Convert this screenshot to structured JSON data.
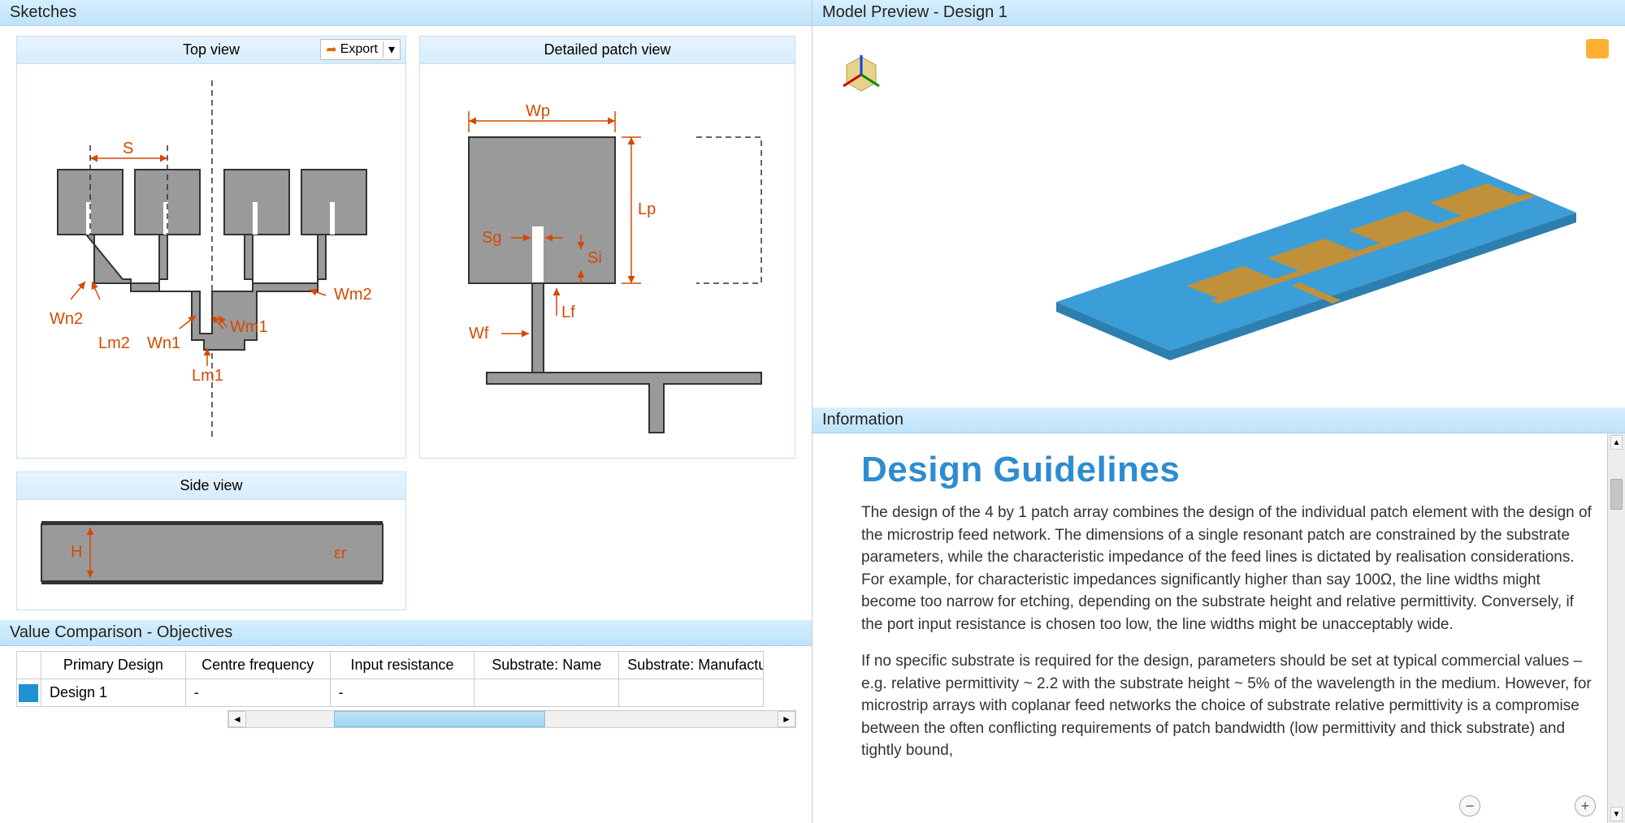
{
  "panels": {
    "sketches_title": "Sketches",
    "model_preview_title": "Model Preview  -  Design 1",
    "information_title": "Information",
    "value_comp_title": "Value Comparison - Objectives"
  },
  "sketches": {
    "top_view_title": "Top view",
    "detailed_view_title": "Detailed patch view",
    "side_view_title": "Side view",
    "export_label": "Export",
    "dim_labels_top": {
      "S": "S",
      "Wn2": "Wn2",
      "Lm2": "Lm2",
      "Wn1": "Wn1",
      "Lm1": "Lm1",
      "Wm1": "Wm1",
      "Wm2": "Wm2"
    },
    "dim_labels_detail": {
      "Wp": "Wp",
      "Lp": "Lp",
      "Sg": "Sg",
      "Si": "Si",
      "Lf": "Lf",
      "Wf": "Wf"
    },
    "dim_labels_side": {
      "H": "H",
      "er": "εr"
    }
  },
  "value_table": {
    "columns": [
      "",
      "Primary Design",
      "Centre frequency",
      "Input resistance",
      "Substrate: Name",
      "Substrate: Manufacturer"
    ],
    "rows": [
      {
        "swatch": "#1e90d4",
        "primary": "Design 1",
        "centre_freq": "-",
        "input_res": "-",
        "sub_name": "",
        "sub_mfr": ""
      }
    ]
  },
  "info": {
    "heading": "Design Guidelines",
    "p1": "The design of the 4 by 1 patch array combines the design of the individual patch element with the design of the microstrip feed network. The dimensions of a single resonant patch are constrained by the substrate parameters, while the characteristic impedance of the feed lines is dictated by realisation considerations. For example, for characteristic impedances significantly higher than say 100Ω, the line widths might become too narrow for etching, depending on the substrate height and relative permittivity. Conversely, if the port input resistance is chosen too low, the line widths might be unacceptably wide.",
    "p2": " If no specific substrate is required for the design, parameters should be set at typical commercial values – e.g. relative permittivity ~ 2.2 with the substrate height ~ 5% of the wavelength in the medium. However, for microstrip arrays with coplanar feed networks the choice of substrate relative permittivity is a compromise between the often conflicting requirements of patch bandwidth (low permittivity and thick substrate) and tightly bound,"
  }
}
